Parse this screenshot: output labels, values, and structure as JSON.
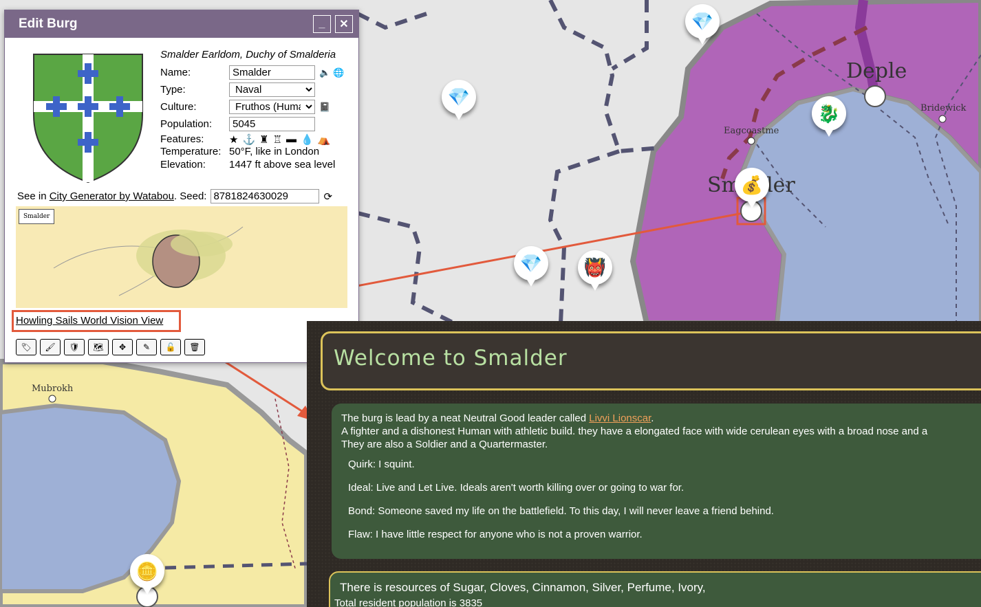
{
  "map": {
    "labels": [
      "Deple",
      "Bridewick",
      "Eagcoastme",
      "Smalder",
      "Mubrokh"
    ],
    "colors": {
      "land": "#e6e6e6",
      "state_purple": "#b065b8",
      "water": "#9eb0d6",
      "yellow_state": "#f5eaa5"
    }
  },
  "dialog": {
    "title": "Edit Burg",
    "state_line": "Smalder Earldom, Duchy of Smalderia",
    "name_label": "Name:",
    "name_value": "Smalder",
    "type_label": "Type:",
    "type_value": "Naval",
    "culture_label": "Culture:",
    "culture_value": "Fruthos (Huma",
    "population_label": "Population:",
    "population_value": "5045",
    "features_label": "Features:",
    "temperature_label": "Temperature:",
    "temperature_value": "50°F, like in London",
    "elevation_label": "Elevation:",
    "elevation_value": "1447 ft above sea level",
    "see_in": "See in",
    "generator_link": "City Generator by Watabou",
    "seed_label": ". Seed:",
    "seed_value": "8781824630029",
    "city_tag": "Smalder",
    "vision_link": "Howling Sails World Vision View"
  },
  "vision": {
    "welcome": "Welcome to Smalder",
    "leader_prefix": "The burg is lead by a neat Neutral Good leader called ",
    "leader_name": "Livvi Lionscar",
    "leader_suffix": ".",
    "desc1": "A fighter and a dishonest Human with athletic build. they have a elongated face with wide cerulean eyes with a broad nose and a",
    "desc2": "They are also a Soldier and a Quartermaster.",
    "quirk": "Quirk: I squint.",
    "ideal": "Ideal: Live and Let Live. Ideals aren't worth killing over or going to war for.",
    "bond": "Bond: Someone saved my life on the battlefield. To this day, I will never leave a friend behind.",
    "flaw": "Flaw: I have little respect for anyone who is not a proven warrior.",
    "resources": "There is resources of Sugar, Cloves, Cinnamon, Silver, Perfume, Ivory,",
    "population": "Total resident population is 3835"
  }
}
